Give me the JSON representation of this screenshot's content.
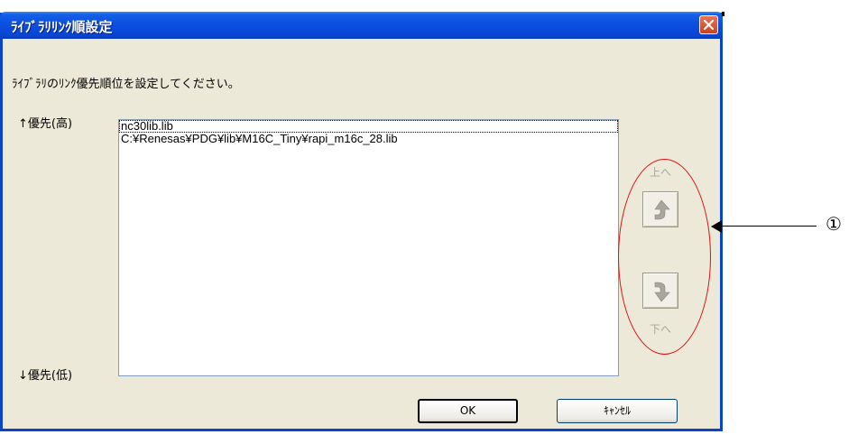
{
  "dialog": {
    "title": "ﾗｲﾌﾞﾗﾘﾘﾝｸ順設定",
    "instruction": "ﾗｲﾌﾞﾗﾘのﾘﾝｸ優先順位を設定してください。",
    "priority_high_label": "↑優先(高)",
    "priority_low_label": "↓優先(低)",
    "libraries": [
      "nc30lib.lib",
      "C:¥Renesas¥PDG¥lib¥M16C_Tiny¥rapi_m16c_28.lib"
    ],
    "up_label": "上へ",
    "down_label": "下へ",
    "ok_label": "OK",
    "cancel_label": "ｷｬﾝｾﾙ"
  },
  "annotation": {
    "callout_number": "①",
    "highlight_color": "#e01010"
  },
  "colors": {
    "titlebar": "#0a4ee0",
    "dialog_bg": "#ece9d8",
    "close_button": "#c8421c"
  },
  "icons": [
    "close-icon",
    "up-arrow-icon",
    "down-arrow-icon"
  ]
}
